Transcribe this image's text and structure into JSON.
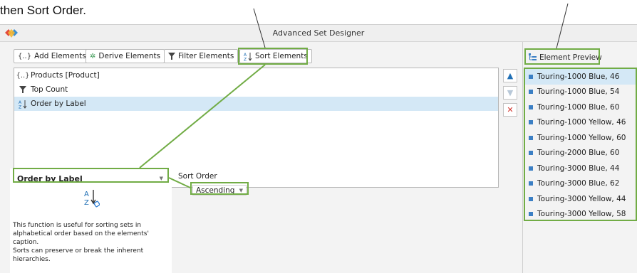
{
  "caption": "then Sort Order.",
  "window": {
    "title": "Advanced Set Designer",
    "logo_icon": "multicolor-diamond-logo"
  },
  "toolbar": {
    "buttons": [
      {
        "label": "Add Elements",
        "icon": "braces-icon",
        "glyph": "{..}"
      },
      {
        "label": "Derive Elements",
        "icon": "gear-icon",
        "glyph": "✲"
      },
      {
        "label": "Filter Elements",
        "icon": "funnel-icon"
      },
      {
        "label": "Sort Elements",
        "icon": "sort-az-icon"
      }
    ]
  },
  "elements": [
    {
      "label": "Products [Product]",
      "icon": "braces-icon",
      "glyph": "{..}",
      "selected": false
    },
    {
      "label": "Top Count",
      "icon": "funnel-icon",
      "selected": false
    },
    {
      "label": "Order by Label",
      "icon": "sort-az-icon",
      "selected": true
    }
  ],
  "side_buttons": [
    {
      "name": "move-up-button",
      "icon": "triangle-up-icon",
      "glyph": "▲",
      "color": "#1f6fb5",
      "enabled": true
    },
    {
      "name": "move-down-button",
      "icon": "triangle-down-icon",
      "glyph": "▼",
      "color": "#b8c8d8",
      "enabled": false
    },
    {
      "name": "delete-button",
      "icon": "x-icon",
      "glyph": "✕",
      "color": "#d2332c",
      "enabled": true
    }
  ],
  "function_panel": {
    "selected": "Order by Label",
    "description": [
      "This function is useful for sorting sets in alphabetical order based on the elements' caption.",
      "Sorts can preserve or break the inherent hierarchies."
    ]
  },
  "sort_order": {
    "label": "Sort Order",
    "value": "Ascending"
  },
  "preview": {
    "header": "Element Preview",
    "items": [
      {
        "label": "Touring-1000 Blue, 46",
        "selected": true
      },
      {
        "label": "Touring-1000 Blue, 54",
        "selected": false
      },
      {
        "label": "Touring-1000 Blue, 60",
        "selected": false
      },
      {
        "label": "Touring-1000 Yellow, 46",
        "selected": false
      },
      {
        "label": "Touring-1000 Yellow, 60",
        "selected": false
      },
      {
        "label": "Touring-2000 Blue, 60",
        "selected": false
      },
      {
        "label": "Touring-3000 Blue, 44",
        "selected": false
      },
      {
        "label": "Touring-3000 Blue, 62",
        "selected": false
      },
      {
        "label": "Touring-3000 Yellow, 44",
        "selected": false
      },
      {
        "label": "Touring-3000 Yellow, 58",
        "selected": false
      }
    ]
  },
  "colors": {
    "highlight": "#71ac45",
    "selection": "#d4e8f6",
    "bullet": "#3b7fc4"
  }
}
